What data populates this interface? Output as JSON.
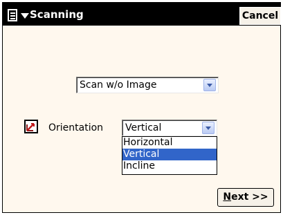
{
  "titlebar": {
    "title": "Scanning",
    "cancel_label": "Cancel"
  },
  "scan_mode": {
    "selected": "Scan w/o Image"
  },
  "orientation": {
    "label": "Orientation",
    "selected": "Vertical",
    "options": [
      "Horizontal",
      "Vertical",
      "Incline"
    ],
    "highlighted": "Vertical"
  },
  "footer": {
    "next_mnemonic": "N",
    "next_rest": "ext >>"
  },
  "colors": {
    "selection": "#3165c9",
    "titlebar": "#000000",
    "panel": "#fff8ee"
  }
}
